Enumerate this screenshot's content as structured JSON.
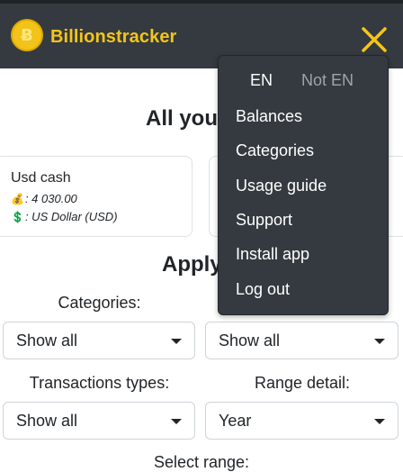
{
  "navbar": {
    "brand": "Billionstracker",
    "logo_glyph": "Ƀ",
    "accent_color": "#f5c518",
    "bg_color": "#343a40",
    "close_icon": "close-icon"
  },
  "main": {
    "title": "All your ba",
    "cards": [
      {
        "name": "Usd cash",
        "amount_icon": "💰",
        "amount": ": 4 030.00",
        "currency_icon": "💲",
        "currency": ": US Dollar (USD)"
      }
    ],
    "filters_title": "Apply fi",
    "filters": {
      "categories_label": "Categories:",
      "categories_value": "Show all",
      "second_value": "Show all",
      "transactions_label": "Transactions types:",
      "transactions_value": "Show all",
      "range_detail_label": "Range detail:",
      "range_detail_value": "Year",
      "select_range_label": "Select range:"
    }
  },
  "dropdown": {
    "lang_en": "EN",
    "lang_not_en": "Not EN",
    "items": [
      "Balances",
      "Categories",
      "Usage guide",
      "Support",
      "Install app",
      "Log out"
    ]
  }
}
